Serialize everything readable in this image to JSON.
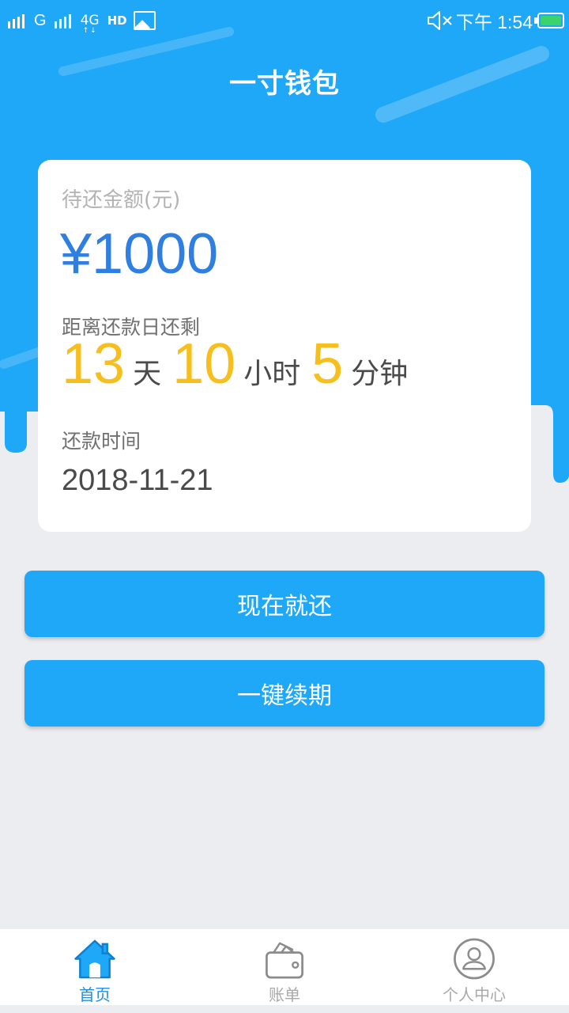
{
  "status_bar": {
    "carrier_label": "G",
    "network_label": "4G",
    "network_arrows": "↑↓",
    "hd_label": "HD",
    "clock": "下午 1:54"
  },
  "header": {
    "title": "一寸钱包"
  },
  "card": {
    "amount_label": "待还金额(元)",
    "amount_value": "¥1000",
    "remaining_label": "距离还款日还剩",
    "countdown": {
      "days": "13",
      "days_unit": "天",
      "hours": "10",
      "hours_unit": "小时",
      "minutes": "5",
      "minutes_unit": "分钟"
    },
    "repay_date_label": "还款时间",
    "repay_date_value": "2018-11-21"
  },
  "actions": {
    "repay_now": "现在就还",
    "renew": "一键续期"
  },
  "bottom_nav": {
    "items": [
      {
        "label": "首页",
        "icon": "home-icon",
        "active": true
      },
      {
        "label": "账单",
        "icon": "wallet-icon",
        "active": false
      },
      {
        "label": "个人中心",
        "icon": "user-icon",
        "active": false
      }
    ]
  },
  "colors": {
    "primary": "#1fa7f8",
    "amount": "#2f7fe0",
    "countdown_number": "#f7bf1e",
    "nav_active": "#1c8ee6",
    "page_background": "#ecedf1"
  }
}
